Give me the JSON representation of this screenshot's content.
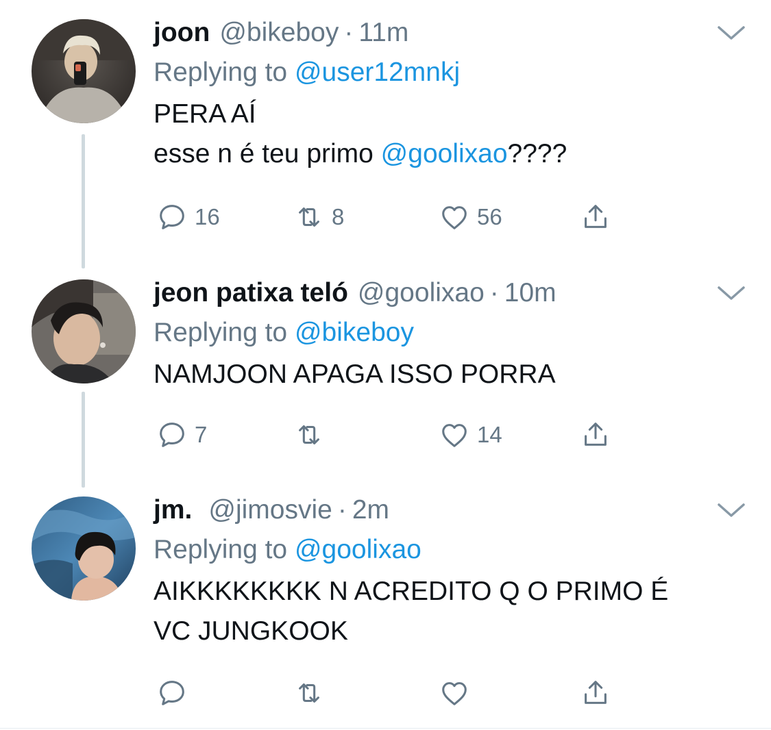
{
  "tweets": [
    {
      "display_name": "joon",
      "handle": "@bikeboy",
      "time": "11m",
      "replying_prefix": "Replying to ",
      "replying_to": "@user12mnkj",
      "text_line1": "PERA AÍ",
      "text_line2_pre": "esse n é teu primo ",
      "text_line2_mention": "@goolixao",
      "text_line2_post": "????",
      "replies": "16",
      "retweets": "8",
      "likes": "56"
    },
    {
      "display_name": "jeon patixa teló",
      "handle": "@goolixao",
      "time": "10m",
      "replying_prefix": "Replying to ",
      "replying_to": "@bikeboy",
      "text_line1": "NAMJOON APAGA ISSO PORRA",
      "replies": "7",
      "retweets": "",
      "likes": "14"
    },
    {
      "display_name": "jm.",
      "handle": "@jimosvie",
      "time": "2m",
      "replying_prefix": "Replying to ",
      "replying_to": "@goolixao",
      "text_line1": "AIKKKKKKKK N ACREDITO Q O PRIMO É",
      "text_line2": "VC JUNGKOOK",
      "replies": "",
      "retweets": "",
      "likes": ""
    }
  ],
  "separator": "·",
  "icons": {
    "reply": "reply-icon",
    "retweet": "retweet-icon",
    "like": "heart-icon",
    "share": "share-icon",
    "menu": "chevron-down-icon"
  },
  "colors": {
    "text": "#0f1419",
    "secondary": "#657786",
    "link": "#1b95e0",
    "thread_line": "#cfd9de"
  }
}
